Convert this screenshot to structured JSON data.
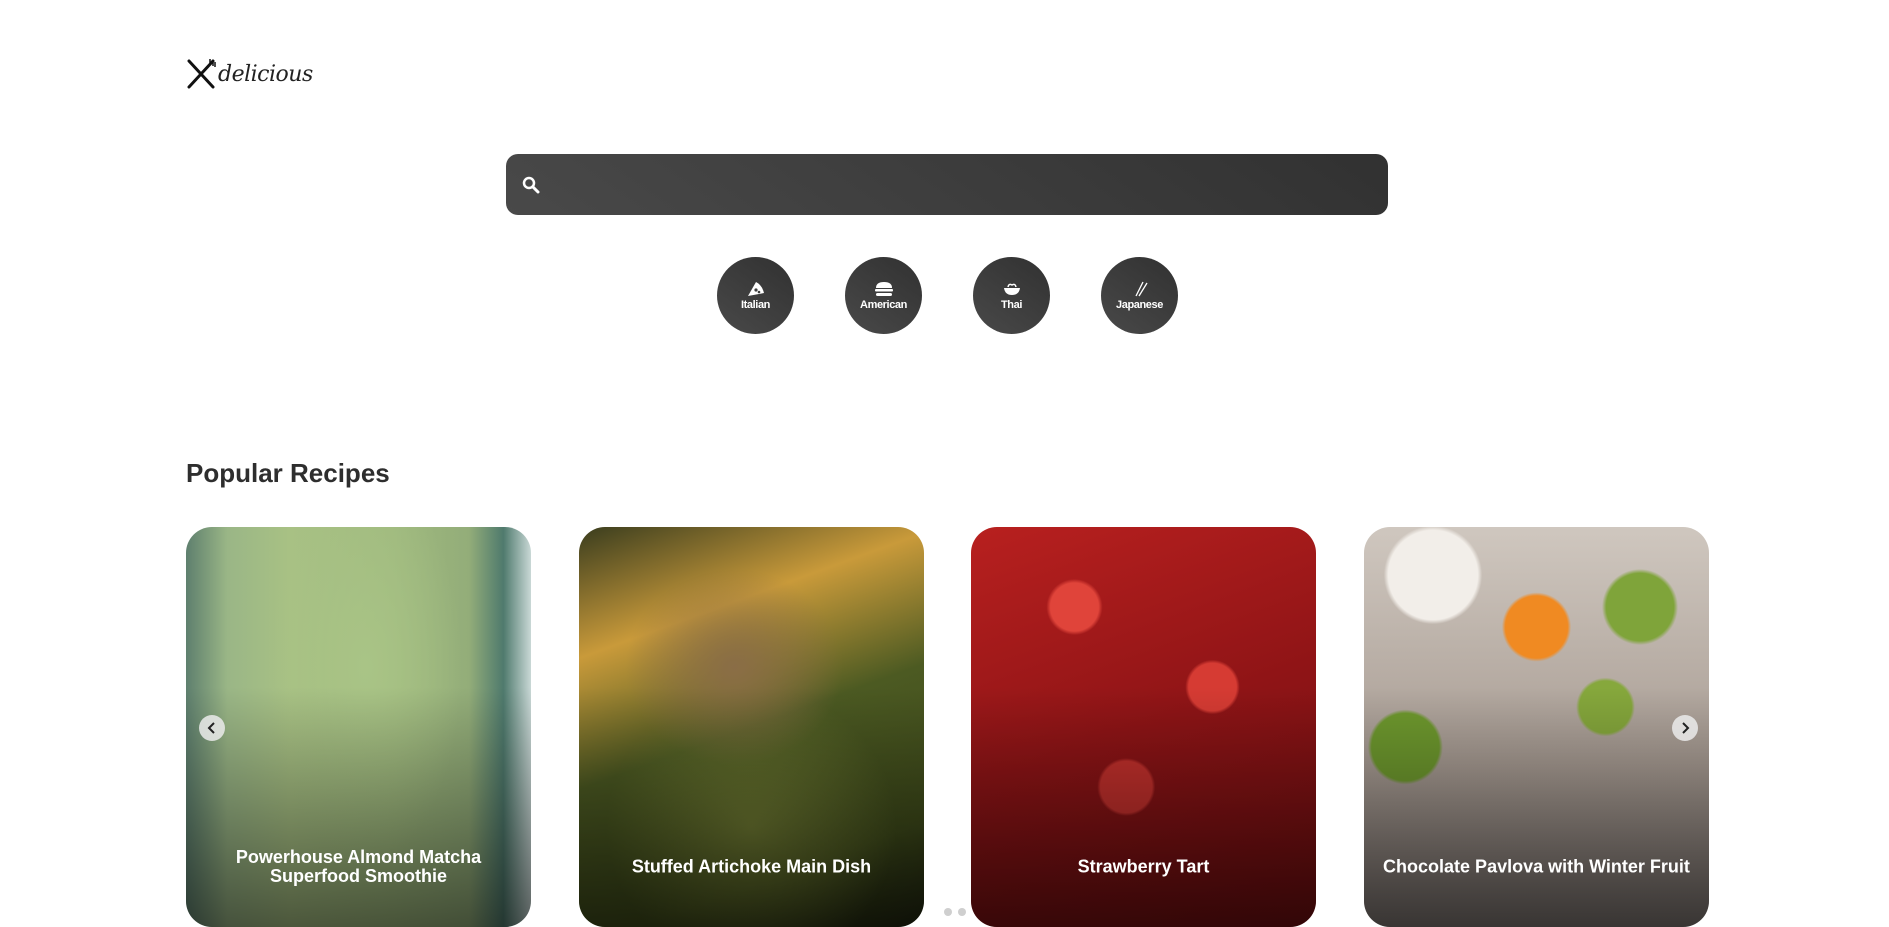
{
  "brand": {
    "name": "delicious",
    "icon": "fork-knife-icon"
  },
  "search": {
    "value": "",
    "placeholder": "",
    "icon": "search-icon"
  },
  "categories": [
    {
      "label": "Italian",
      "icon": "pizza-icon"
    },
    {
      "label": "American",
      "icon": "burger-icon"
    },
    {
      "label": "Thai",
      "icon": "noodle-bowl-icon"
    },
    {
      "label": "Japanese",
      "icon": "chopsticks-icon"
    }
  ],
  "popular": {
    "title": "Popular Recipes",
    "recipes": [
      {
        "title": "Powerhouse Almond Matcha Superfood Smoothie"
      },
      {
        "title": "Stuffed Artichoke Main Dish"
      },
      {
        "title": "Strawberry Tart"
      },
      {
        "title": "Chocolate Pavlova with Winter Fruit"
      }
    ],
    "pagination": {
      "pages": 2
    }
  },
  "colors": {
    "accent_dark": "#313131",
    "accent_light": "#494949",
    "text": "#2e2e2e"
  }
}
